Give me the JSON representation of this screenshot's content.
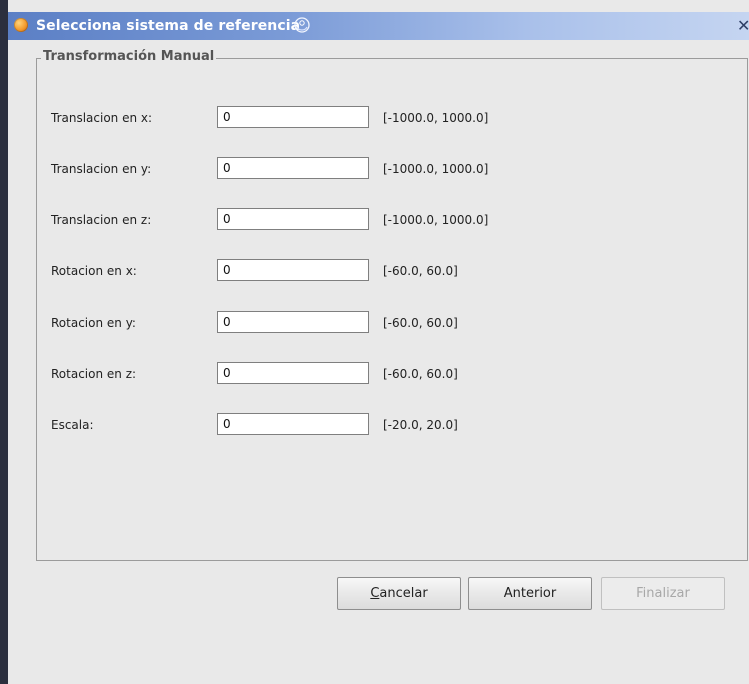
{
  "window": {
    "title": "Selecciona sistema de referencia",
    "close_glyph": "✕",
    "title_icon": "app-icon",
    "title_swirl_icon": "swirl-icon"
  },
  "group": {
    "title": "Transformación Manual"
  },
  "fields": [
    {
      "label": "Translacion en x:",
      "value": "0",
      "range": "[-1000.0, 1000.0]"
    },
    {
      "label": "Translacion en y:",
      "value": "0",
      "range": "[-1000.0, 1000.0]"
    },
    {
      "label": "Translacion en z:",
      "value": "0",
      "range": "[-1000.0, 1000.0]"
    },
    {
      "label": "Rotacion en x:",
      "value": "0",
      "range": "[-60.0, 60.0]"
    },
    {
      "label": "Rotacion en y:",
      "value": "0",
      "range": "[-60.0, 60.0]"
    },
    {
      "label": "Rotacion en z:",
      "value": "0",
      "range": "[-60.0, 60.0]"
    },
    {
      "label": "Escala:",
      "value": "0",
      "range": "[-20.0, 20.0]"
    }
  ],
  "buttons": {
    "cancel_prefix": "C",
    "cancel_rest": "ancelar",
    "back": "Anterior",
    "finish": "Finalizar"
  }
}
